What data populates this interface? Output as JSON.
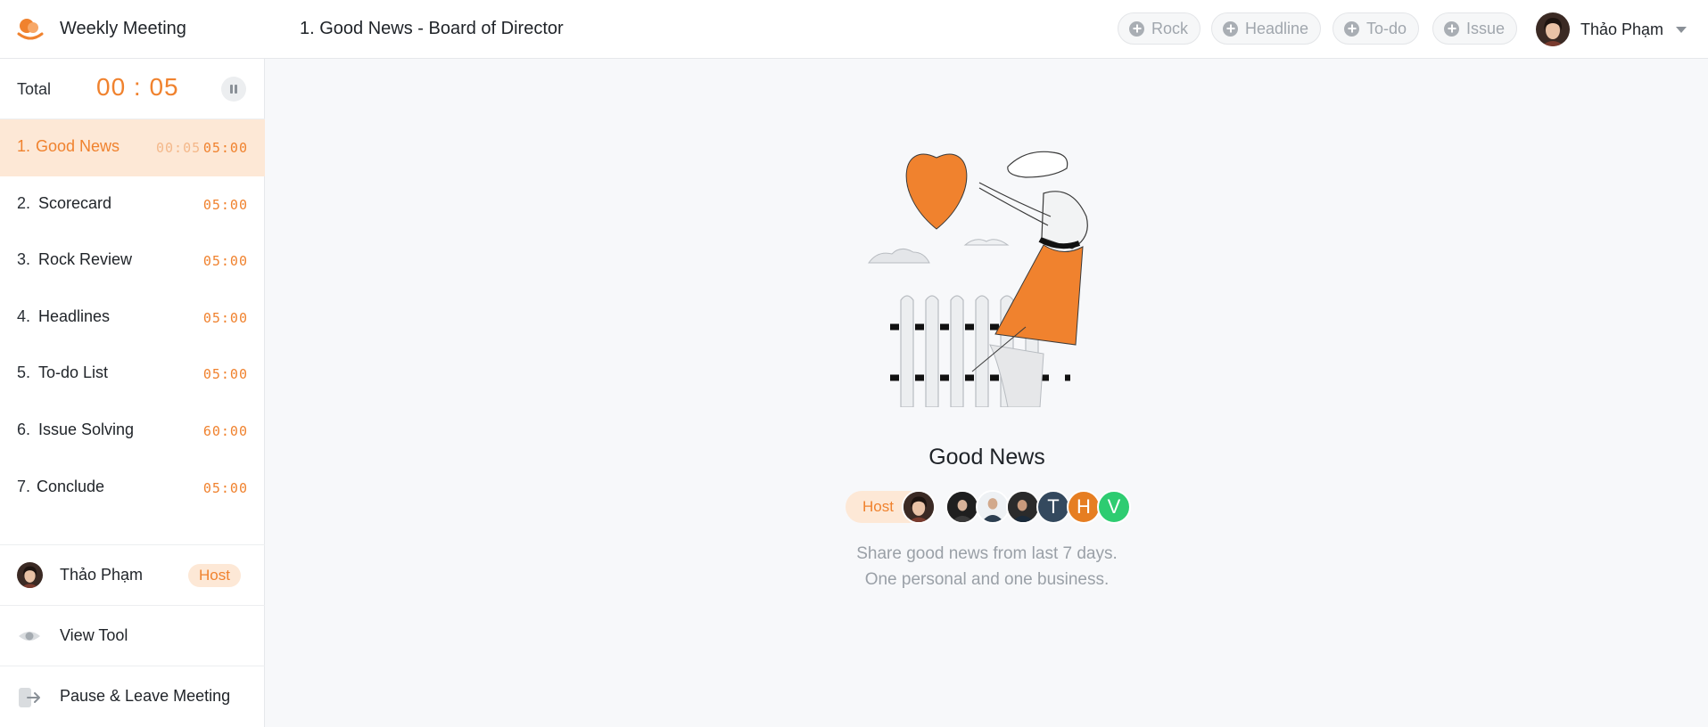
{
  "app": {
    "title": "Weekly Meeting",
    "logo_icon": "app-logo-icon"
  },
  "header": {
    "page_title": "1. Good News - Board of Director",
    "actions": [
      {
        "label": "Rock",
        "icon": "plus-circle-icon"
      },
      {
        "label": "Headline",
        "icon": "plus-circle-icon"
      },
      {
        "label": "To-do",
        "icon": "plus-circle-icon"
      },
      {
        "label": "Issue",
        "icon": "plus-circle-icon"
      }
    ],
    "user": {
      "name": "Thảo Phạm"
    }
  },
  "sidebar": {
    "timer": {
      "label": "Total",
      "value": "00 : 05"
    },
    "agenda": [
      {
        "num": "1.",
        "label": "Good News",
        "elapsed": "00:05",
        "duration": "05:00",
        "active": true
      },
      {
        "num": "2.",
        "label": "Scorecard",
        "duration": "05:00"
      },
      {
        "num": "3.",
        "label": "Rock Review",
        "duration": "05:00"
      },
      {
        "num": "4.",
        "label": "Headlines",
        "duration": "05:00"
      },
      {
        "num": "5.",
        "label": "To-do List",
        "duration": "05:00"
      },
      {
        "num": "6.",
        "label": "Issue Solving",
        "duration": "60:00"
      },
      {
        "num": "7.",
        "label": "Conclude",
        "duration": "05:00"
      }
    ],
    "host": {
      "name": "Thảo Phạm",
      "badge": "Host"
    },
    "view_tool": "View Tool",
    "leave": "Pause & Leave Meeting"
  },
  "main": {
    "title": "Good News",
    "host_label": "Host",
    "participants": [
      {
        "initial": "T",
        "color": "#34495e"
      },
      {
        "initial": "H",
        "color": "#e67e22"
      },
      {
        "initial": "V",
        "color": "#2ecc71"
      }
    ],
    "description_line1": "Share good news from last 7 days.",
    "description_line2": "One personal and one business."
  },
  "colors": {
    "accent": "#f0822e",
    "accent_soft": "#fde8d6",
    "muted": "#9aa0a7"
  }
}
